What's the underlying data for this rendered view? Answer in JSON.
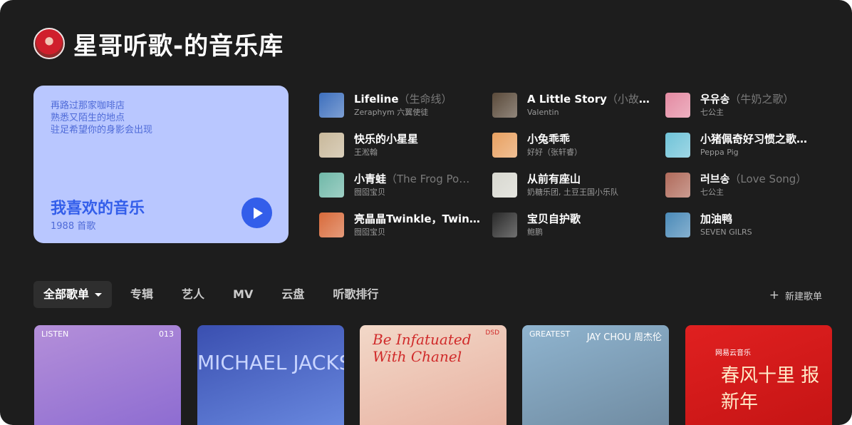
{
  "header": {
    "title": "星哥听歌-的音乐库"
  },
  "liked": {
    "lyrics": [
      "再路过那家咖啡店",
      "熟悉又陌生的地点",
      "驻足希望你的身影会出现"
    ],
    "title": "我喜欢的音乐",
    "count": "1988 首歌"
  },
  "tracks": [
    {
      "title": "Lifeline",
      "alias": "（生命线）",
      "artist": "Zeraphym 六翼使徒",
      "cover": "#3d6fbd"
    },
    {
      "title": "A Little Story",
      "alias": "（小故事）",
      "artist": "Valentin",
      "cover": "#5a4a3a"
    },
    {
      "title": "우유송",
      "alias": "（牛奶之歌）",
      "artist": "七公主",
      "cover": "#e48aa2"
    },
    {
      "title": "快乐的小星星",
      "alias": "",
      "artist": "王淞翰",
      "cover": "#c8b89a"
    },
    {
      "title": "小兔乖乖",
      "alias": "",
      "artist": "好好（张轩睿）",
      "cover": "#e8a060"
    },
    {
      "title": "小猪佩奇好习惯之歌…",
      "alias": "",
      "artist": "Peppa Pig",
      "cover": "#6fc3d8"
    },
    {
      "title": "小青蛙",
      "alias": "（The Frog Po…",
      "artist": "囫囵宝贝",
      "cover": "#6fb8a8"
    },
    {
      "title": "从前有座山",
      "alias": "",
      "artist": "奶糖乐团, 土豆王国小乐队",
      "cover": "#d8d8d0"
    },
    {
      "title": "러브송",
      "alias": "（Love Song）",
      "artist": "七公主",
      "cover": "#b06a5a"
    },
    {
      "title": "亮晶晶Twinkle，Twin…",
      "alias": "",
      "artist": "囫囵宝贝",
      "cover": "#d86a3a"
    },
    {
      "title": "宝贝自护歌",
      "alias": "",
      "artist": "鲍鹏",
      "cover": "#2a2a2a"
    },
    {
      "title": "加油鸭",
      "alias": "",
      "artist": "SEVEN GILRS",
      "cover": "#4a8ab8"
    }
  ],
  "tabs": [
    "全部歌单",
    "专辑",
    "艺人",
    "MV",
    "云盘",
    "听歌排行"
  ],
  "new_playlist": "新建歌单",
  "playlists": [
    {
      "text_left": "LISTEN",
      "text_right": "013",
      "colors": [
        "#b48fd9",
        "#8c6bd1"
      ]
    },
    {
      "text_left": "MICHAEL JACKSON",
      "text_right": "",
      "colors": [
        "#3a4fb0",
        "#6a8ae0"
      ]
    },
    {
      "text_left": "Be Infatuated With Chanel",
      "text_right": "DSD",
      "colors": [
        "#f2d8c8",
        "#e8b0a0"
      ]
    },
    {
      "text_left": "GREATEST",
      "text_right": "JAY CHOU 周杰伦",
      "colors": [
        "#8fb4cf",
        "#6f8aa0"
      ]
    },
    {
      "text_left": "春风十里 报新年",
      "text_right": "网易云音乐",
      "colors": [
        "#e02020",
        "#c41414"
      ]
    }
  ]
}
